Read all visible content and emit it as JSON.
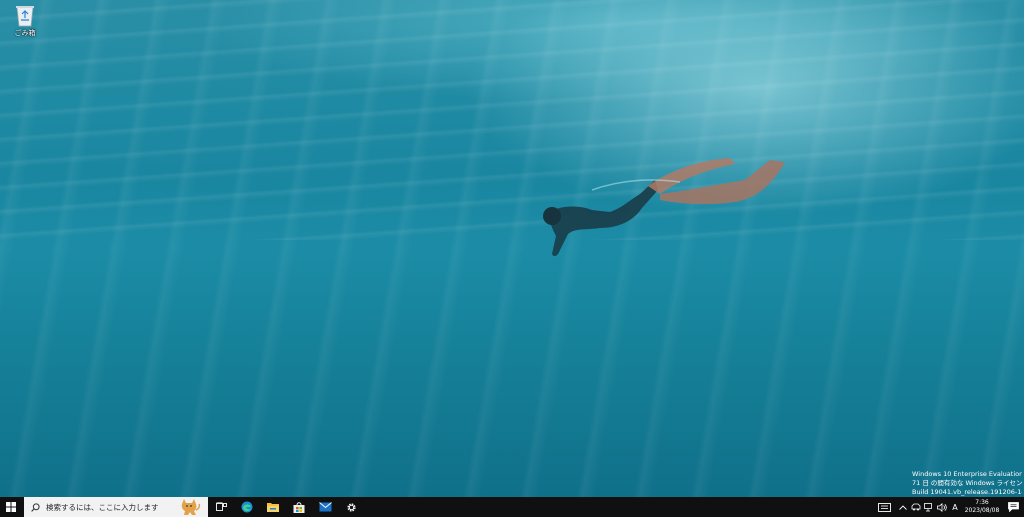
{
  "desktop": {
    "icons": [
      {
        "label": "ごみ箱",
        "icon": "recycle-bin-icon"
      }
    ],
    "watermark": {
      "line1": "Windows 10 Enterprise Evaluation",
      "line2": "71 日 の間有効な Windows ライセンス",
      "line3": "Build 19041.vb_release.191206-1406"
    }
  },
  "taskbar": {
    "search_placeholder": "検索するには、ここに入力します",
    "pinned": [
      {
        "name": "task-view-icon"
      },
      {
        "name": "edge-icon"
      },
      {
        "name": "file-explorer-icon"
      },
      {
        "name": "store-icon"
      },
      {
        "name": "mail-icon"
      },
      {
        "name": "settings-icon"
      }
    ],
    "tray": {
      "ime_mode": "A",
      "time": "7:36",
      "date": "2023/08/08"
    }
  },
  "colors": {
    "taskbar_bg": "#101010",
    "search_bg": "#f2f2f2",
    "water": "#1a86a0"
  }
}
